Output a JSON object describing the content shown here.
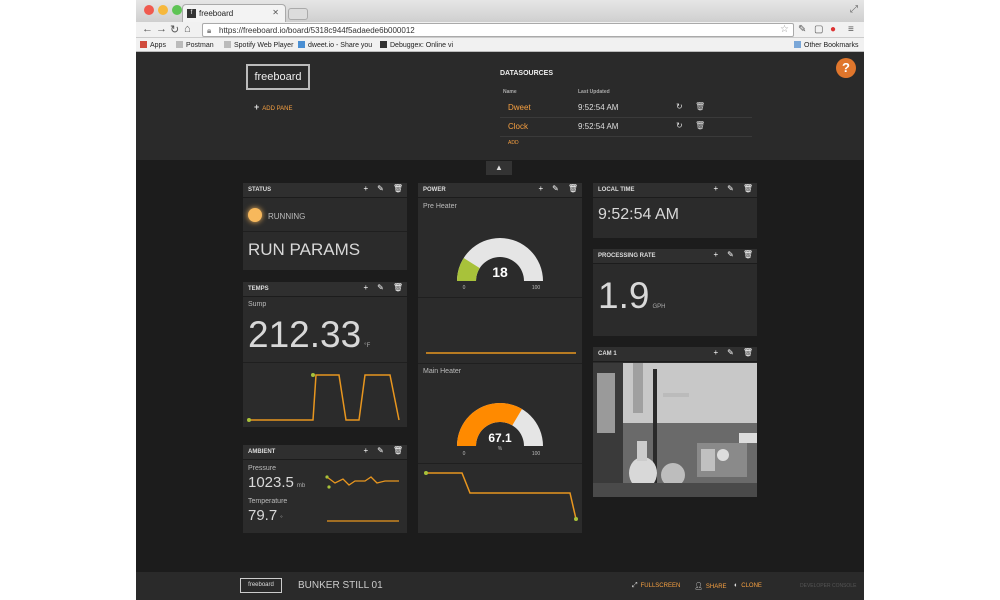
{
  "browser": {
    "tab_title": "freeboard",
    "tab_icon": "freeboard-favicon",
    "url": "https://freeboard.io/board/5318c944f5adaede6b000012",
    "bookmarks": [
      {
        "label": "Apps"
      },
      {
        "label": "Postman"
      },
      {
        "label": "Spotify Web Player"
      },
      {
        "label": "dweet.io - Share you"
      },
      {
        "label": "Debuggex: Online vi"
      }
    ],
    "other_bookmarks": "Other Bookmarks"
  },
  "header": {
    "logo": "freeboard",
    "add_pane": "ADD PANE",
    "datasources_title": "DATASOURCES",
    "col_name": "Name",
    "col_updated": "Last Updated",
    "datasources": [
      {
        "name": "Dweet",
        "updated": "9:52:54 AM"
      },
      {
        "name": "Clock",
        "updated": "9:52:54 AM"
      }
    ],
    "add": "ADD",
    "help": "?"
  },
  "panes": {
    "status": {
      "title": "STATUS",
      "indicator_label": "RUNNING",
      "indicator_color": "#f7b85c",
      "text": "RUN PARAMS"
    },
    "temps": {
      "title": "TEMPS",
      "label": "Sump",
      "value": "212.33",
      "unit": "°F"
    },
    "ambient": {
      "title": "AMBIENT",
      "pressure_label": "Pressure",
      "pressure_value": "1023.5",
      "pressure_unit": "mb",
      "temp_label": "Temperature",
      "temp_value": "79.7",
      "temp_unit": "°"
    },
    "power": {
      "title": "POWER",
      "pre_label": "Pre Heater",
      "pre_value": "18",
      "pre_min": "0",
      "pre_max": "100",
      "pre_fraction": 0.18,
      "pre_color": "#a8c23a",
      "main_label": "Main Heater",
      "main_value": "67.1",
      "main_unit": "%",
      "main_min": "0",
      "main_max": "100",
      "main_fraction": 0.671,
      "main_color": "#ff8a00"
    },
    "local_time": {
      "title": "LOCAL TIME",
      "value": "9:52:54 AM"
    },
    "processing": {
      "title": "PROCESSING RATE",
      "value": "1.9",
      "unit": "GPH"
    },
    "cam": {
      "title": "CAM 1"
    }
  },
  "footer": {
    "logo": "freeboard",
    "board_name": "BUNKER STILL 01",
    "fullscreen": "FULLSCREEN",
    "share": "SHARE",
    "clone": "CLONE",
    "dev_console": "DEVELOPER CONSOLE"
  },
  "colors": {
    "accent": "#f7a041",
    "sparkline": "#e8961f",
    "sparkpoint": "#a8c23a"
  }
}
